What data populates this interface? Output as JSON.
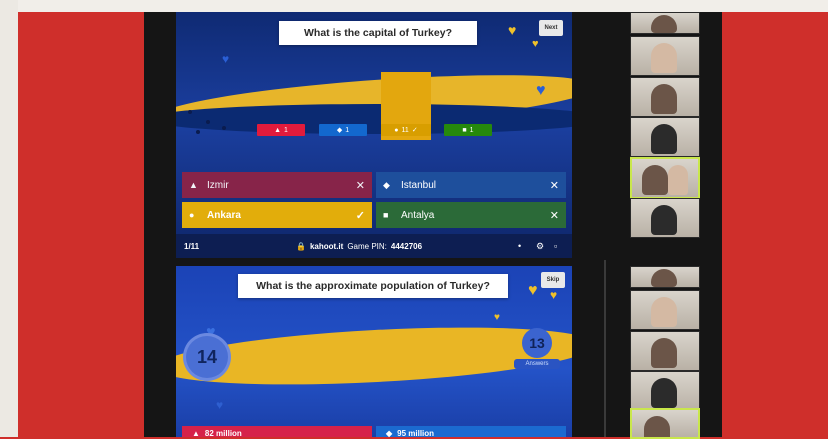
{
  "screen_top": {
    "question": "What is the capital of Turkey?",
    "next_label": "Next",
    "stats": [
      {
        "color": "red",
        "shape": "▲",
        "count": "1"
      },
      {
        "color": "blue",
        "shape": "◆",
        "count": "1"
      },
      {
        "color": "yellow",
        "shape": "●",
        "count": "11",
        "correct": true
      },
      {
        "color": "green",
        "shape": "■",
        "count": "1"
      }
    ],
    "answers": [
      {
        "shape": "▲",
        "label": "Izmir",
        "mark": "✕"
      },
      {
        "shape": "◆",
        "label": "Istanbul",
        "mark": "✕"
      },
      {
        "shape": "●",
        "label": "Ankara",
        "mark": "✓"
      },
      {
        "shape": "■",
        "label": "Antalya",
        "mark": "✕"
      }
    ],
    "footer": {
      "count": "1/11",
      "site": "kahoot.it",
      "pin_label": "Game PIN:",
      "pin": "4442706"
    }
  },
  "screen_bottom": {
    "question": "What is the approximate population of Turkey?",
    "skip_label": "Skip",
    "timer": "14",
    "answers_count": "13",
    "answers_label": "Answers",
    "answers": [
      {
        "shape": "▲",
        "label": "82 million"
      },
      {
        "shape": "◆",
        "label": "95 million"
      }
    ]
  },
  "colors": {
    "background": "#cf2f2b",
    "kahoot_blue": "#1b3fa0",
    "kahoot_yellow": "#e7b52a",
    "red": "#e21b3c",
    "blue": "#1368ce",
    "yellow": "#d89e00",
    "green": "#26890c"
  }
}
